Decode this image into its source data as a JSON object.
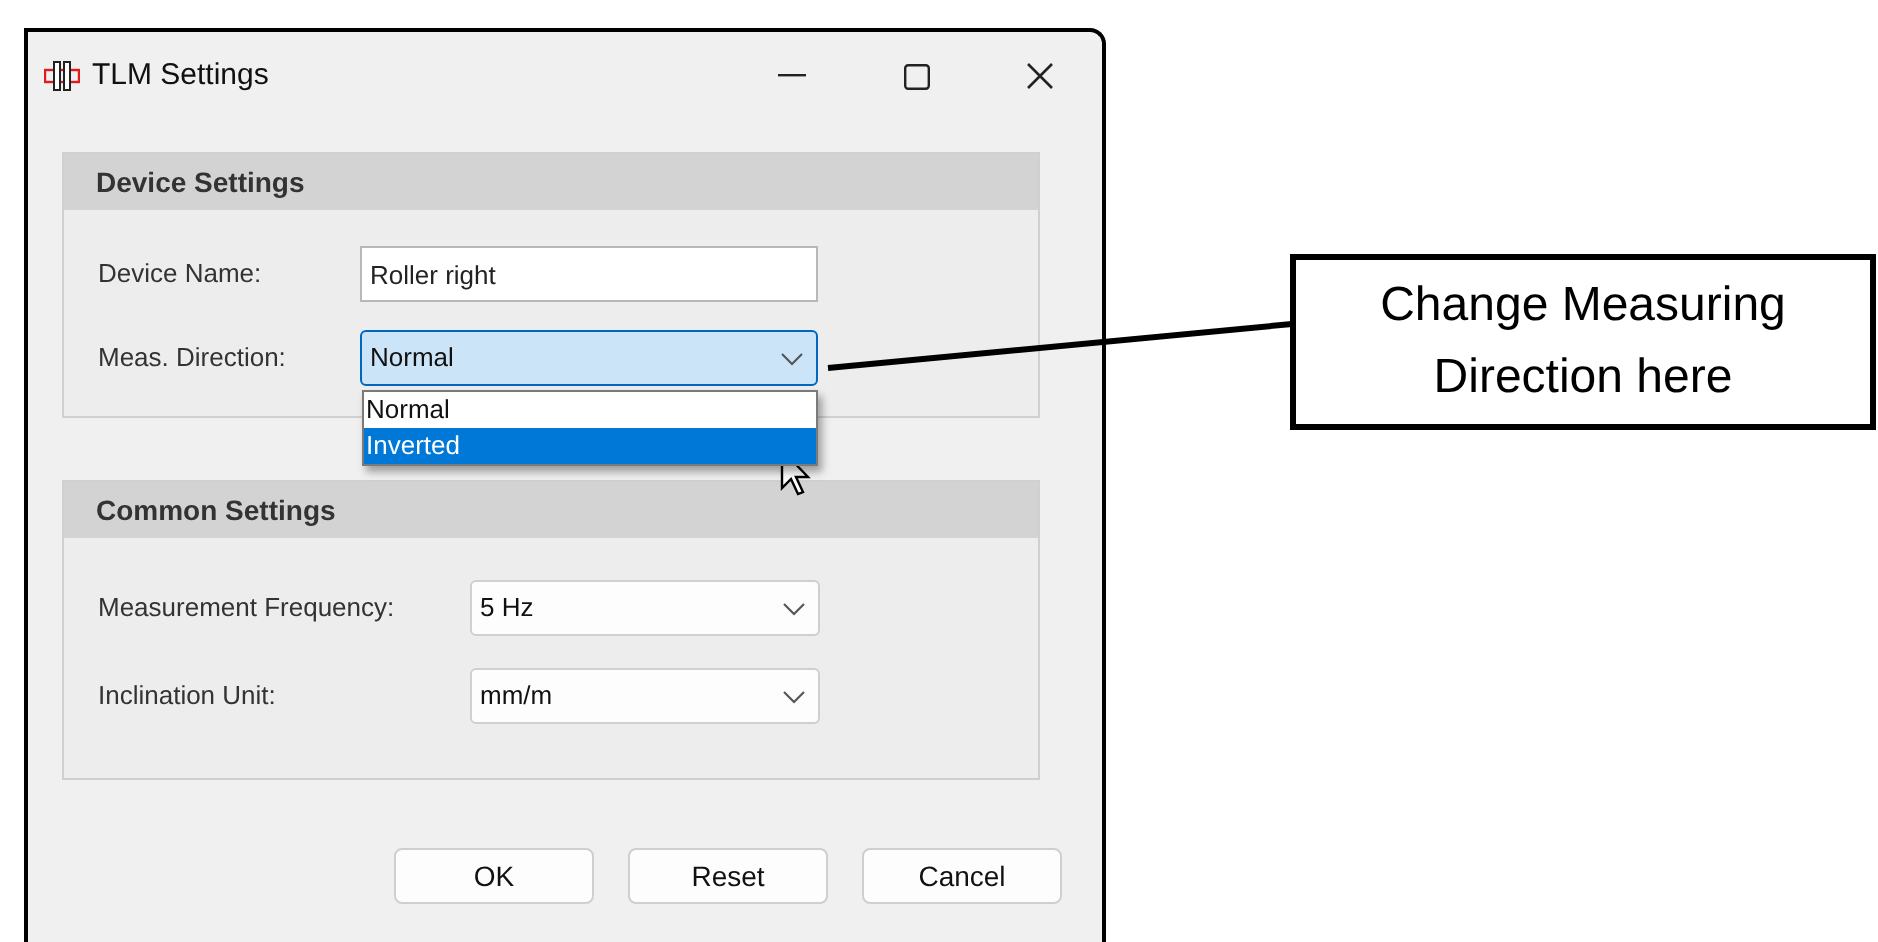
{
  "window": {
    "title": "TLM Settings"
  },
  "groups": [
    {
      "title": "Device Settings",
      "fields": [
        {
          "kind": "text",
          "label": "Device Name:",
          "value": "Roller right"
        },
        {
          "kind": "combo",
          "label": "Meas. Direction:",
          "value": "Normal",
          "expanded": true,
          "options": [
            {
              "label": "Normal",
              "highlighted": false
            },
            {
              "label": "Inverted",
              "highlighted": true
            }
          ]
        }
      ]
    },
    {
      "title": "Common Settings",
      "fields": [
        {
          "kind": "combo",
          "label": "Measurement Frequency:",
          "value": "5 Hz",
          "expanded": false
        },
        {
          "kind": "combo",
          "label": "Inclination Unit:",
          "value": "mm/m",
          "expanded": false
        }
      ]
    }
  ],
  "buttons": [
    "OK",
    "Reset",
    "Cancel"
  ],
  "callout": {
    "text": "Change Measuring Direction here"
  }
}
